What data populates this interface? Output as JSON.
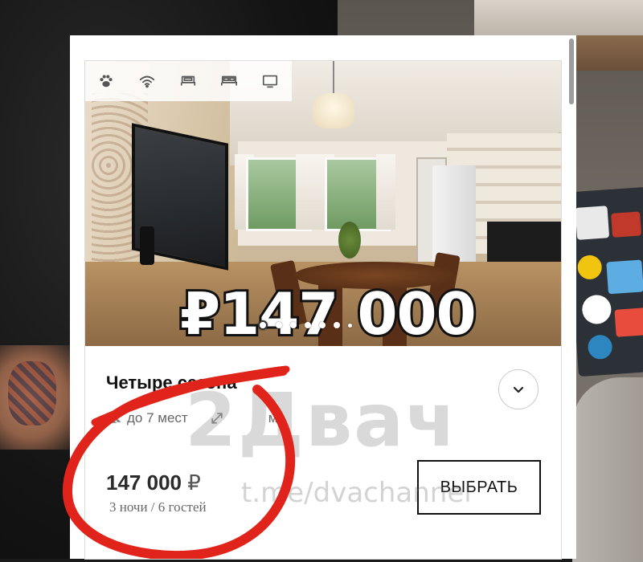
{
  "listing": {
    "amenities": [
      {
        "icon": "paw-icon"
      },
      {
        "icon": "wifi-icon"
      },
      {
        "icon": "single-bed-icon"
      },
      {
        "icon": "double-bed-icon"
      },
      {
        "icon": "tv-icon"
      }
    ],
    "photo_price_overlay": "₽147 000",
    "carousel": {
      "total": 7,
      "active": 1
    },
    "title": "Четыре сезона",
    "guests": "до 7 мест",
    "area_unit": "м²",
    "price": "147 000",
    "currency": "₽",
    "price_details": "3 ночи / 6 гостей",
    "select_button": "ВЫБРАТЬ"
  },
  "watermark": {
    "logo": "2Двач",
    "link": "t.me/dvachannel"
  },
  "colors": {
    "annotation": "#e0241b",
    "button_border": "#111111",
    "text_muted": "#666666"
  }
}
